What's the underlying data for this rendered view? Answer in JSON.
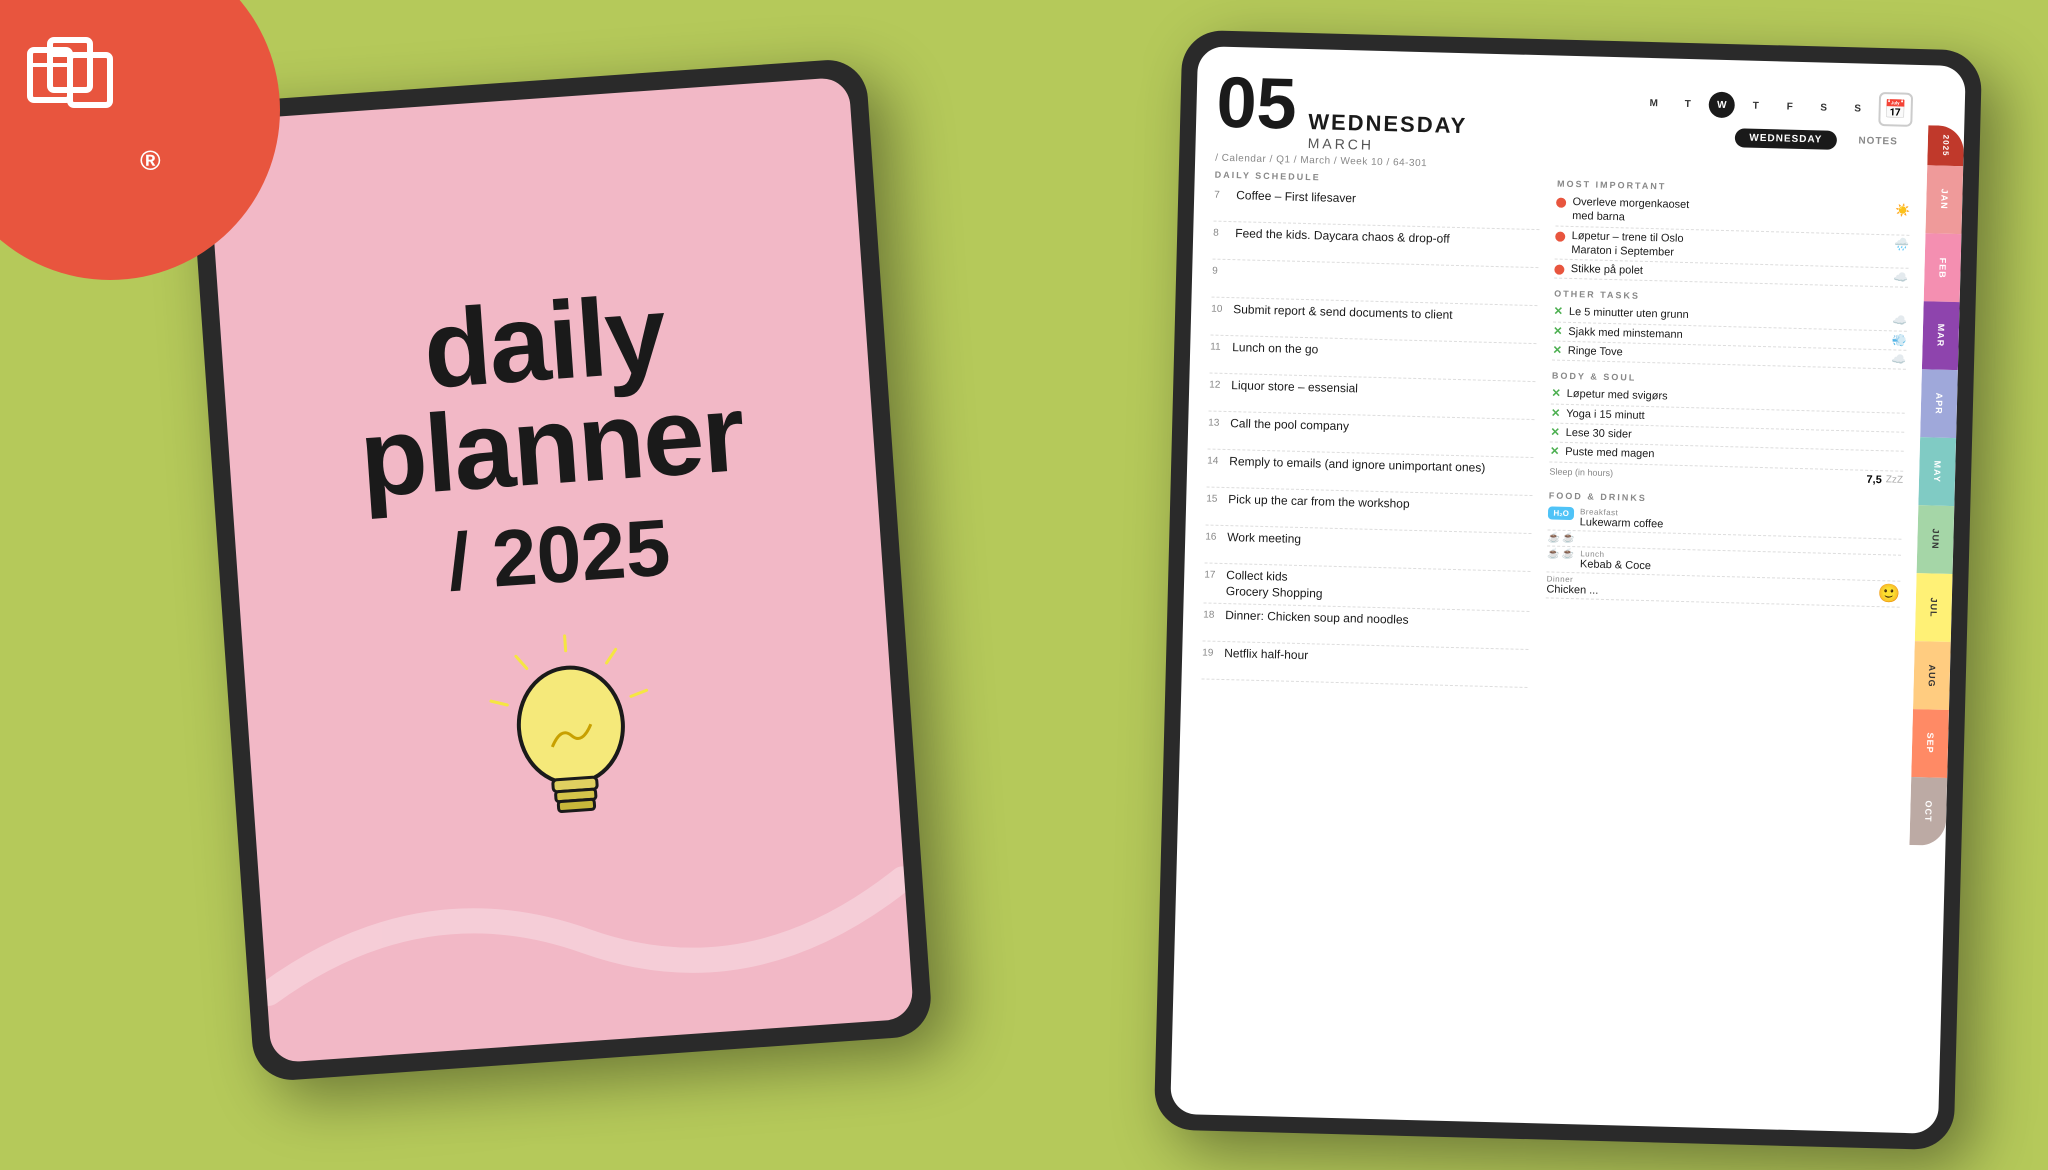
{
  "background_color": "#b5c95a",
  "logo": {
    "circle_color": "#e8553e",
    "registered": "®"
  },
  "tablet_left": {
    "screen_color": "#f2b8c6",
    "title_line1": "daily",
    "title_line2": "planner",
    "year": "/ 2025"
  },
  "tablet_right": {
    "header": {
      "day_number": "05",
      "day_name": "WEDNESDAY",
      "month_name": "MARCH",
      "breadcrumb": "/ Calendar / Q1 / March / Week 10 / 64-301",
      "week_days": [
        "M",
        "T",
        "W",
        "T",
        "F",
        "S",
        "S"
      ],
      "active_day": "W"
    },
    "view_tabs": [
      {
        "label": "WEDNESDAY",
        "active": true
      },
      {
        "label": "NOTES",
        "active": false
      }
    ],
    "daily_schedule_label": "DAILY SCHEDULE",
    "schedule": [
      {
        "time": "7",
        "text": "Coffee – First lifesaver"
      },
      {
        "time": "8",
        "text": "Feed the kids. Daycara chaos & drop-off"
      },
      {
        "time": "9",
        "text": ""
      },
      {
        "time": "10",
        "text": "Submit report & send documents to client"
      },
      {
        "time": "11",
        "text": "Lunch on the go"
      },
      {
        "time": "12",
        "text": "Liquor store – essensial"
      },
      {
        "time": "13",
        "text": "Call the pool company"
      },
      {
        "time": "14",
        "text": "Remply to emails (and ignore unimportant ones)"
      },
      {
        "time": "15",
        "text": "Pick up the car from the workshop"
      },
      {
        "time": "16",
        "text": "Work meeting"
      },
      {
        "time": "17",
        "text": "Collect kids\nGrocery Shopping"
      },
      {
        "time": "18",
        "text": "Dinner: Chicken soup and noodles"
      },
      {
        "time": "19",
        "text": "Netflix half-hour"
      }
    ],
    "most_important_label": "MOST IMPORTANT",
    "most_important": [
      {
        "text": "Overleve morgenkaoset med barna",
        "weather": "☀"
      },
      {
        "text": "Løpetur – trene til Oslo Maraton i September",
        "weather": "🌧"
      },
      {
        "text": "Stikke på polet",
        "weather": "☁"
      }
    ],
    "other_tasks_label": "OTHER TASKS",
    "other_tasks": [
      {
        "text": "Le 5 minutter uten grunn",
        "weather": "☁"
      },
      {
        "text": "Sjakk med minstemann",
        "weather": "💨"
      },
      {
        "text": "Ringe Tove",
        "weather": "☁"
      }
    ],
    "body_soul_label": "BODY & SOUL",
    "body_soul": [
      {
        "text": "Løpetur med svigørs"
      },
      {
        "text": "Yoga i 15 minutt"
      },
      {
        "text": "Lese 30 sider"
      },
      {
        "text": "Puste med magen"
      }
    ],
    "sleep_label": "Sleep (in hours)",
    "sleep_value": "7,5",
    "sleep_zzz": "ZzZ",
    "food_drinks_label": "FOOD & DRINKS",
    "meals": [
      {
        "meal": "Breakfast",
        "text": "Lukewarm coffee"
      },
      {
        "meal": "Lunch",
        "text": "Kebab & Coce"
      },
      {
        "meal": "Dinner",
        "text": "Chicken ..."
      }
    ],
    "month_tabs": [
      {
        "label": "2025",
        "color": "#e57373"
      },
      {
        "label": "JAN",
        "color": "#ef9a9a"
      },
      {
        "label": "FEB",
        "color": "#f48fb1"
      },
      {
        "label": "MAR",
        "color": "#ce93d8"
      },
      {
        "label": "APR",
        "color": "#9fa8da"
      },
      {
        "label": "MAY",
        "color": "#80cbc4"
      },
      {
        "label": "JUN",
        "color": "#a5d6a7"
      },
      {
        "label": "JUL",
        "color": "#fff176"
      },
      {
        "label": "AUG",
        "color": "#ffcc80"
      },
      {
        "label": "SEP",
        "color": "#ffab91"
      },
      {
        "label": "OCT",
        "color": "#bcaaa4"
      }
    ]
  }
}
